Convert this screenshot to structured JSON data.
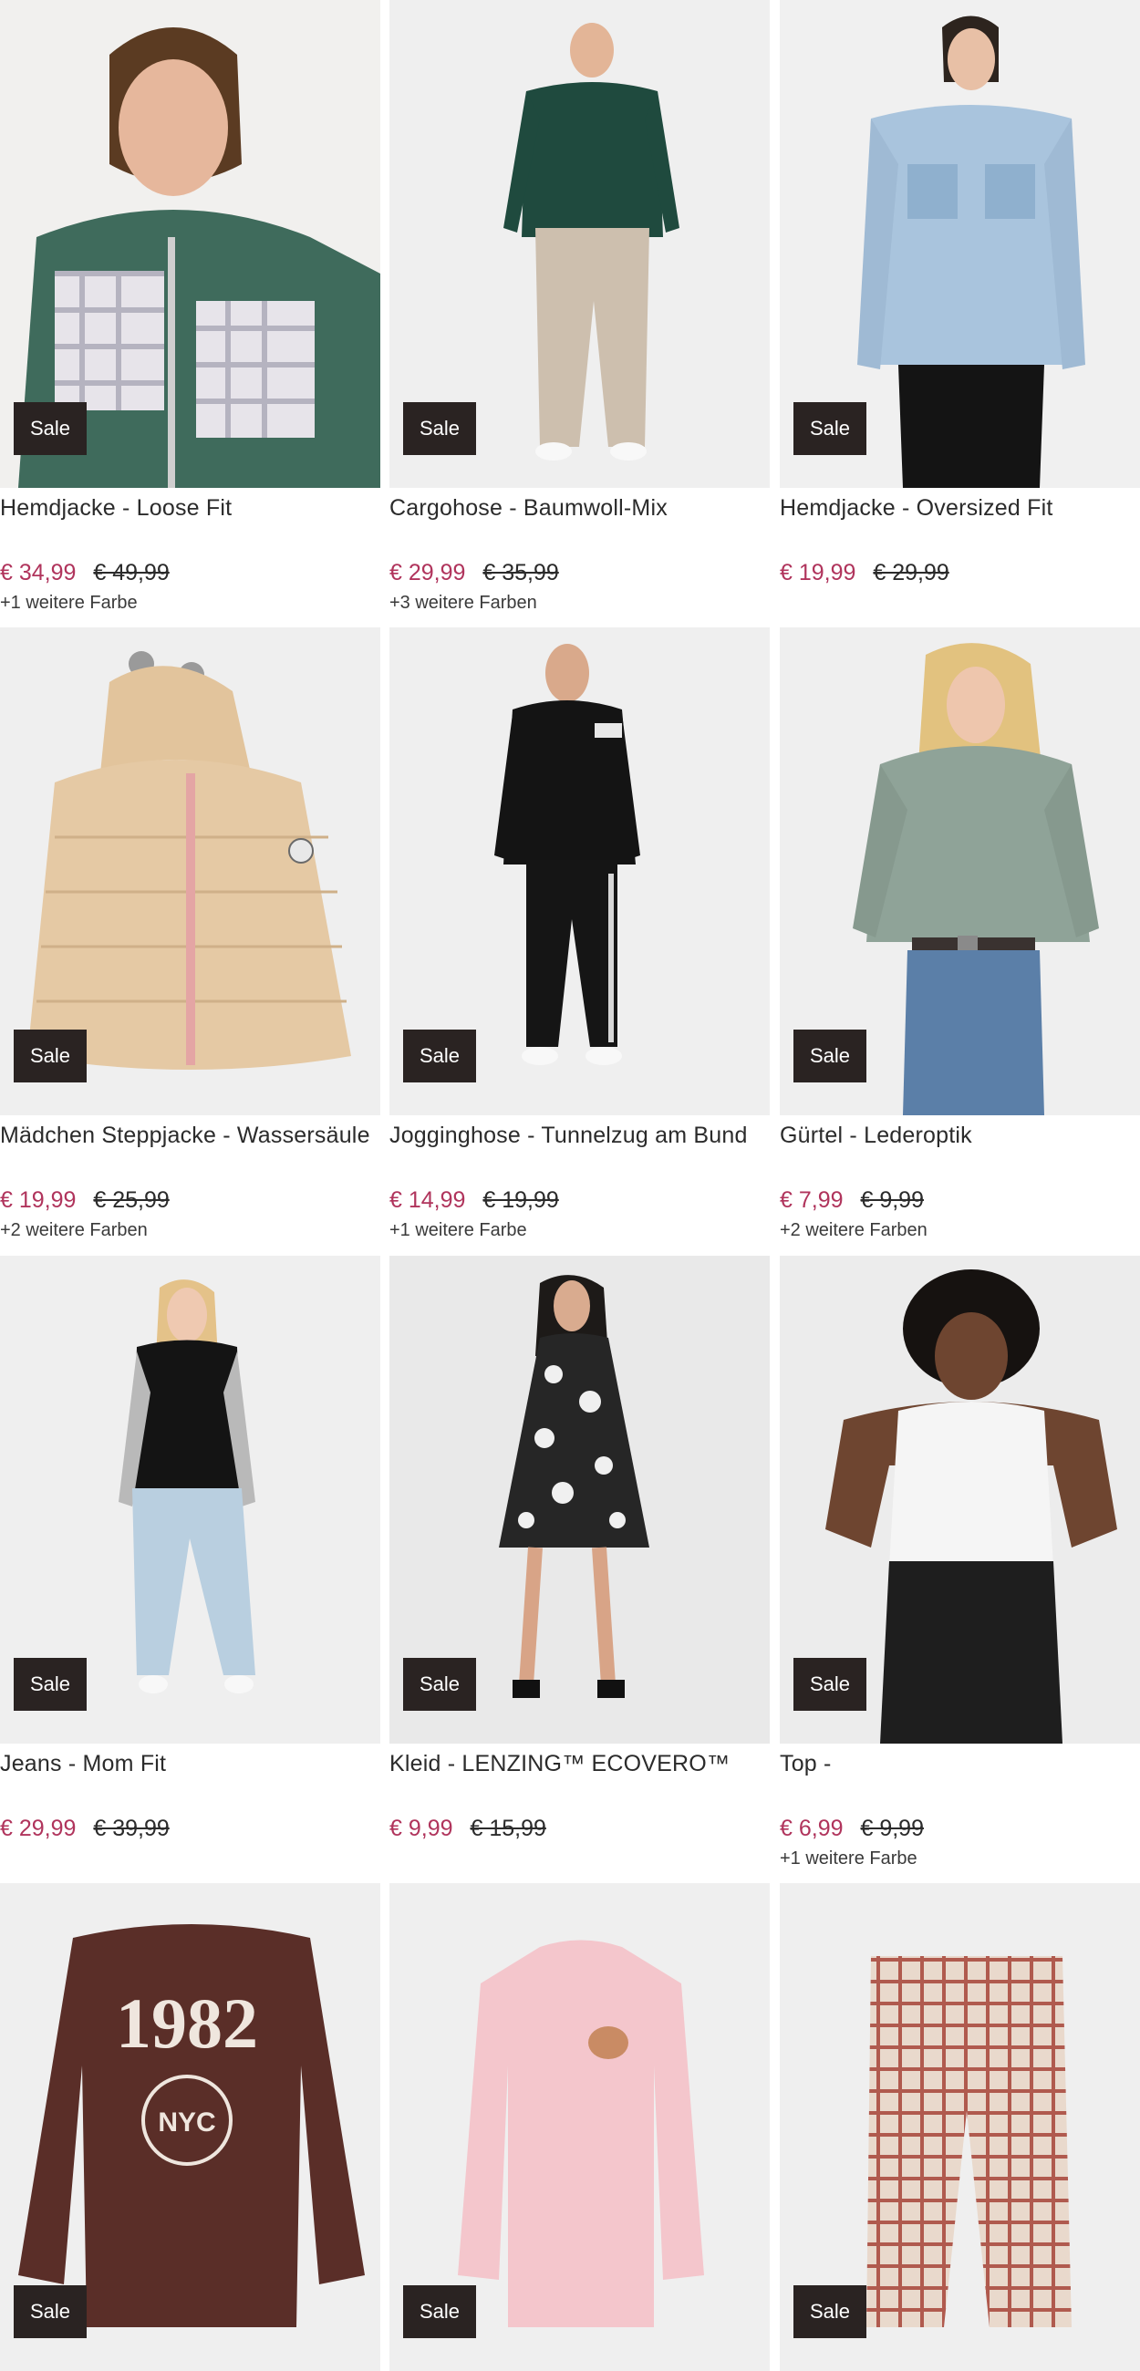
{
  "sale_label": "Sale",
  "colors": {
    "price": "#b0345c",
    "sale_badge": "#2a2322",
    "image_bg": "#efefef"
  },
  "products": [
    {
      "name": "Hemdjacke - Loose Fit",
      "price": "€ 34,99",
      "old_price": "€ 49,99",
      "more_colors": "+1 weitere Farbe",
      "image": "man-plaid-shirt-jacket"
    },
    {
      "name": "Cargohose - Baumwoll-Mix",
      "price": "€ 29,99",
      "old_price": "€ 35,99",
      "more_colors": "+3 weitere Farben",
      "image": "man-green-sweater-cargo-pants"
    },
    {
      "name": "Hemdjacke - Oversized Fit",
      "price": "€ 19,99",
      "old_price": "€ 29,99",
      "more_colors": "",
      "image": "woman-denim-shirt-jacket"
    },
    {
      "name": "Mädchen Steppjacke - Wassersäule",
      "price": "€ 19,99",
      "old_price": "€ 25,99",
      "more_colors": "+2 weitere Farben",
      "image": "beige-puffer-jacket"
    },
    {
      "name": "Jogginghose - Tunnelzug am Bund",
      "price": "€ 14,99",
      "old_price": "€ 19,99",
      "more_colors": "+1 weitere Farbe",
      "image": "man-black-hoodie-joggers"
    },
    {
      "name": "Gürtel - Lederoptik",
      "price": "€ 7,99",
      "old_price": "€ 9,99",
      "more_colors": "+2 weitere Farben",
      "image": "woman-knit-sweater-jeans"
    },
    {
      "name": "Jeans - Mom Fit",
      "price": "€ 29,99",
      "old_price": "€ 39,99",
      "more_colors": "",
      "image": "woman-black-vest-mom-jeans"
    },
    {
      "name": "Kleid - LENZING™ ECOVERO™",
      "price": "€ 9,99",
      "old_price": "€ 15,99",
      "more_colors": "",
      "image": "woman-floral-dress"
    },
    {
      "name": "Top -",
      "price": "€ 6,99",
      "old_price": "€ 9,99",
      "more_colors": "+1 weitere Farbe",
      "image": "woman-white-tank-top"
    },
    {
      "name": "",
      "price": "",
      "old_price": "",
      "more_colors": "",
      "image": "brown-1982-longsleeve"
    },
    {
      "name": "",
      "price": "",
      "old_price": "",
      "more_colors": "",
      "image": "pink-turtleneck-top"
    },
    {
      "name": "",
      "price": "",
      "old_price": "",
      "more_colors": "",
      "image": "checked-baby-pants"
    }
  ],
  "prints": {
    "shirt_1982": "1982",
    "shirt_nyc": "NYC"
  }
}
